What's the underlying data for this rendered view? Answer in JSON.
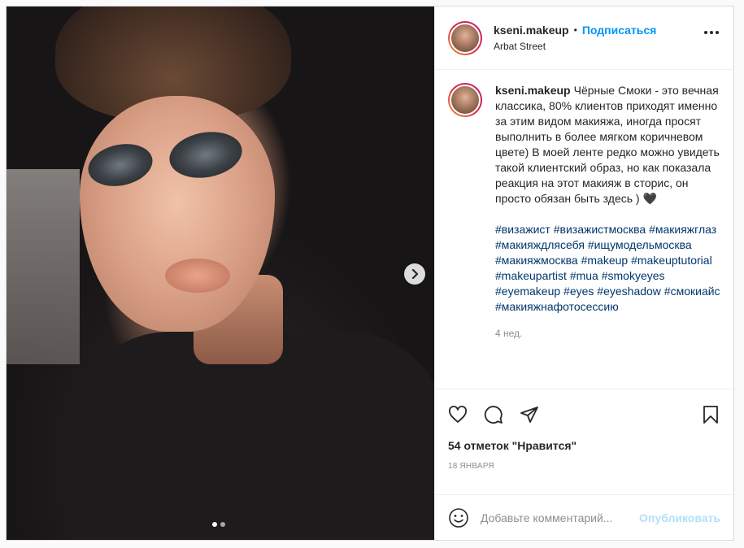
{
  "post": {
    "username": "kseni.makeup",
    "bullet": "•",
    "follow_label": "Подписаться",
    "location": "Arbat Street",
    "caption_text": "Чёрные Смоки - это вечная классика, 80% клиентов приходят именно за этим видом макияжа, иногда просят выполнить в более мягком коричневом цвете) В моей ленте редко можно увидеть такой клиентский образ, но как показала реакция на этот макияж в сторис, он просто обязан быть здесь ) 🖤",
    "hashtags": "#визажист #визажистмосква #макияжглаз #макияждлясебя #ищумодельмосква #макияжмосква #makeup #makeuptutorial #makeupartist #mua #smokyeyes #eyemakeup #eyes #eyeshadow #смокиайс #макияжнафотосессию",
    "time_ago": "4 нед.",
    "likes": "54 отметок \"Нравится\"",
    "date": "18 ЯНВАРЯ",
    "comment_placeholder": "Добавьте комментарий...",
    "publish_label": "Опубликовать"
  },
  "carousel": {
    "total": 2,
    "current": 1
  },
  "icons": {
    "like": "heart-icon",
    "comment": "comment-icon",
    "share": "share-icon",
    "save": "bookmark-icon",
    "emoji": "emoji-icon",
    "more": "more-icon",
    "next": "chevron-right-icon"
  },
  "colors": {
    "accent": "#0095f6",
    "hashtag": "#00376b",
    "muted": "#8e8e8e",
    "publish_disabled": "#b2dffc"
  }
}
